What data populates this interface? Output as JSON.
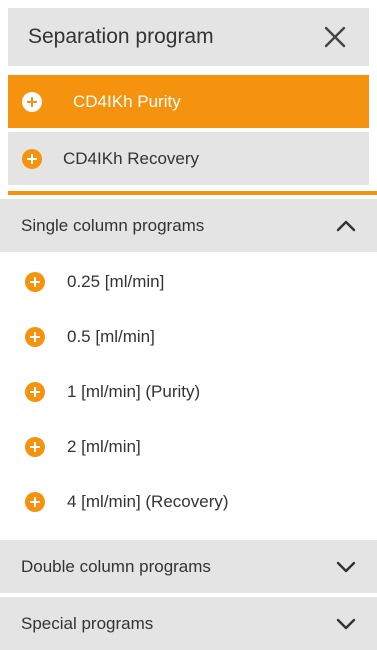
{
  "header": {
    "title": "Separation program",
    "close_icon": "close-icon"
  },
  "programs": [
    {
      "label": "CD4IKh Purity",
      "selected": true
    },
    {
      "label": "CD4IKh Recovery",
      "selected": false
    }
  ],
  "sections": {
    "single": {
      "label": "Single column programs",
      "expanded": true,
      "items": [
        {
          "label": "0.25 [ml/min]"
        },
        {
          "label": "0.5 [ml/min]"
        },
        {
          "label": "1 [ml/min] (Purity)"
        },
        {
          "label": "2 [ml/min]"
        },
        {
          "label": "4 [ml/min] (Recovery)"
        }
      ]
    },
    "double": {
      "label": "Double column programs",
      "expanded": false
    },
    "special": {
      "label": "Special programs",
      "expanded": false
    }
  },
  "colors": {
    "accent": "#f6930e",
    "panel_gray": "#e4e4e4",
    "text": "#333333"
  },
  "icons": {
    "plus": "plus-circle-icon",
    "chevron_up": "chevron-up-icon",
    "chevron_down": "chevron-down-icon"
  }
}
